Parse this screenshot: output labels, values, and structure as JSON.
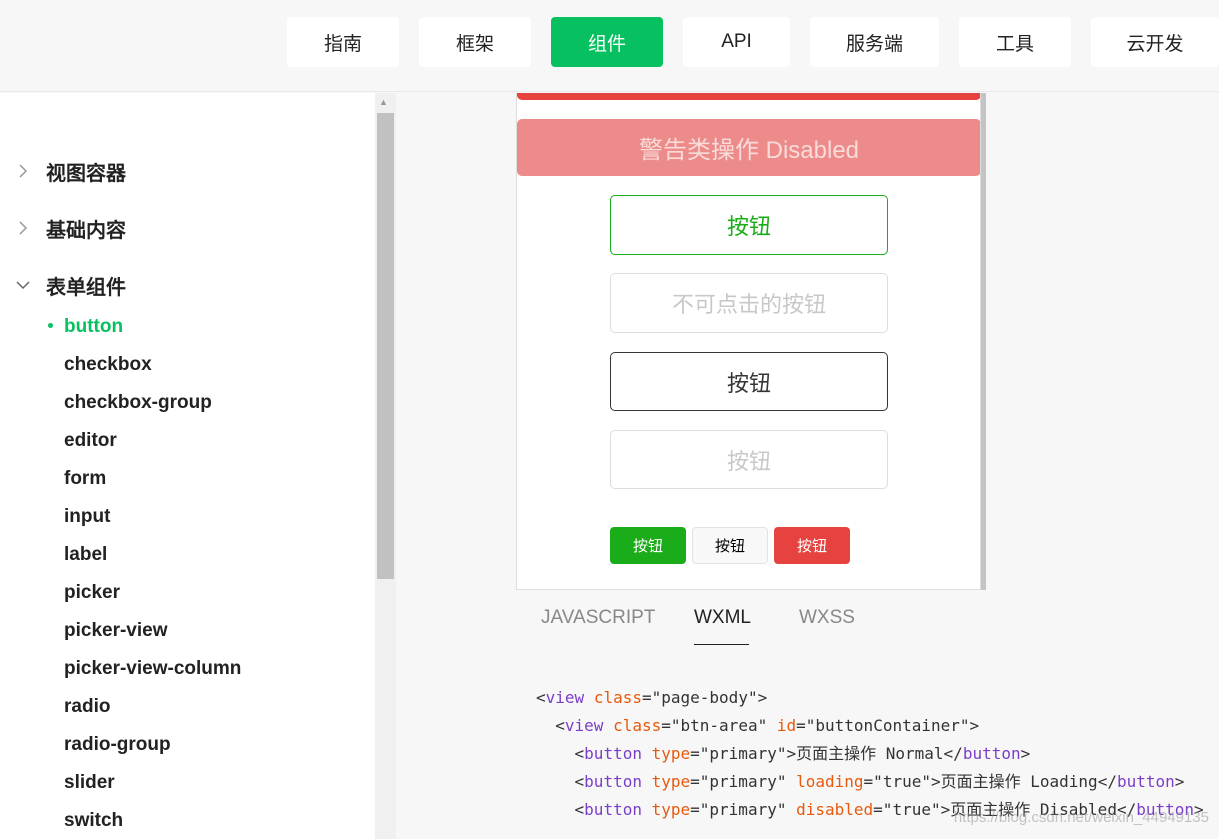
{
  "top_nav": {
    "items": [
      {
        "label": "指南",
        "active": false
      },
      {
        "label": "框架",
        "active": false
      },
      {
        "label": "组件",
        "active": true
      },
      {
        "label": "API",
        "active": false
      },
      {
        "label": "服务端",
        "active": false
      },
      {
        "label": "工具",
        "active": false
      },
      {
        "label": "云开发",
        "active": false
      }
    ]
  },
  "sidebar": {
    "categories": [
      {
        "label": "视图容器",
        "expanded": false
      },
      {
        "label": "基础内容",
        "expanded": false
      },
      {
        "label": "表单组件",
        "expanded": true
      }
    ],
    "items": [
      {
        "label": "button",
        "active": true
      },
      {
        "label": "checkbox"
      },
      {
        "label": "checkbox-group"
      },
      {
        "label": "editor"
      },
      {
        "label": "form"
      },
      {
        "label": "input"
      },
      {
        "label": "label"
      },
      {
        "label": "picker"
      },
      {
        "label": "picker-view"
      },
      {
        "label": "picker-view-column"
      },
      {
        "label": "radio"
      },
      {
        "label": "radio-group"
      },
      {
        "label": "slider"
      },
      {
        "label": "switch"
      }
    ]
  },
  "preview": {
    "warn_disabled_label": "警告类操作 Disabled",
    "plain_primary_label": "按钮",
    "plain_disabled_label": "不可点击的按钮",
    "plain_default_label": "按钮",
    "plain_default_disabled_label": "按钮",
    "mini_primary_label": "按钮",
    "mini_default_label": "按钮",
    "mini_warn_label": "按钮"
  },
  "code_tabs": {
    "tabs": [
      "JAVASCRIPT",
      "WXML",
      "WXSS"
    ],
    "active": "WXML"
  },
  "code": {
    "lines": [
      {
        "tag": "view",
        "attrs": [
          [
            "class",
            "page-body"
          ]
        ],
        "text": "",
        "close": false
      },
      {
        "tag": "view",
        "attrs": [
          [
            "class",
            "btn-area"
          ],
          [
            "id",
            "buttonContainer"
          ]
        ],
        "text": "",
        "close": false
      },
      {
        "tag": "button",
        "attrs": [
          [
            "type",
            "primary"
          ]
        ],
        "text": "页面主操作 Normal",
        "close": true
      },
      {
        "tag": "button",
        "attrs": [
          [
            "type",
            "primary"
          ],
          [
            "loading",
            "true"
          ]
        ],
        "text": "页面主操作 Loading",
        "close": true
      },
      {
        "tag": "button",
        "attrs": [
          [
            "type",
            "primary"
          ],
          [
            "disabled",
            "true"
          ]
        ],
        "text": "页面主操作 Disabled",
        "close": true
      }
    ]
  },
  "watermark": "https://blog.csdn.net/weixin_44949135",
  "colors": {
    "brand_green": "#07c160",
    "button_green": "#1aad19",
    "warn_red": "#e64340"
  }
}
